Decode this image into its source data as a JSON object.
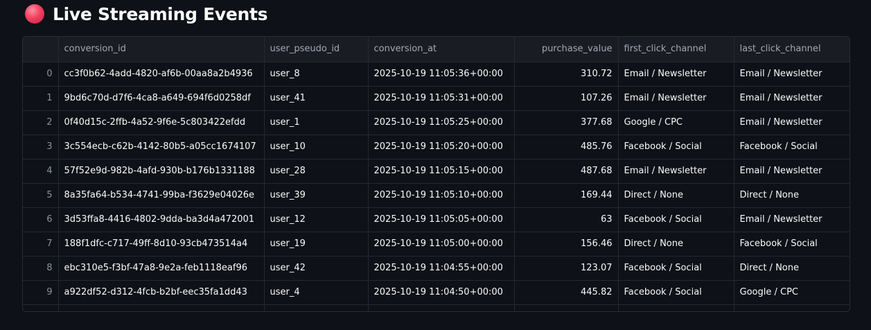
{
  "header": {
    "title": "Live Streaming Events",
    "icon": "red-circle-icon",
    "icon_color": "#f0415f"
  },
  "table": {
    "columns": [
      "",
      "conversion_id",
      "user_pseudo_id",
      "conversion_at",
      "purchase_value",
      "first_click_channel",
      "last_click_channel"
    ],
    "rows": [
      {
        "idx": "0",
        "conversion_id": "cc3f0b62-4add-4820-af6b-00aa8a2b4936",
        "user_pseudo_id": "user_8",
        "conversion_at": "2025-10-19 11:05:36+00:00",
        "purchase_value": "310.72",
        "first_click_channel": "Email / Newsletter",
        "last_click_channel": "Email / Newsletter"
      },
      {
        "idx": "1",
        "conversion_id": "9bd6c70d-d7f6-4ca8-a649-694f6d0258df",
        "user_pseudo_id": "user_41",
        "conversion_at": "2025-10-19 11:05:31+00:00",
        "purchase_value": "107.26",
        "first_click_channel": "Email / Newsletter",
        "last_click_channel": "Email / Newsletter"
      },
      {
        "idx": "2",
        "conversion_id": "0f40d15c-2ffb-4a52-9f6e-5c803422efdd",
        "user_pseudo_id": "user_1",
        "conversion_at": "2025-10-19 11:05:25+00:00",
        "purchase_value": "377.68",
        "first_click_channel": "Google / CPC",
        "last_click_channel": "Email / Newsletter"
      },
      {
        "idx": "3",
        "conversion_id": "3c554ecb-c62b-4142-80b5-a05cc1674107",
        "user_pseudo_id": "user_10",
        "conversion_at": "2025-10-19 11:05:20+00:00",
        "purchase_value": "485.76",
        "first_click_channel": "Facebook / Social",
        "last_click_channel": "Facebook / Social"
      },
      {
        "idx": "4",
        "conversion_id": "57f52e9d-982b-4afd-930b-b176b1331188",
        "user_pseudo_id": "user_28",
        "conversion_at": "2025-10-19 11:05:15+00:00",
        "purchase_value": "487.68",
        "first_click_channel": "Email / Newsletter",
        "last_click_channel": "Email / Newsletter"
      },
      {
        "idx": "5",
        "conversion_id": "8a35fa64-b534-4741-99ba-f3629e04026e",
        "user_pseudo_id": "user_39",
        "conversion_at": "2025-10-19 11:05:10+00:00",
        "purchase_value": "169.44",
        "first_click_channel": "Direct / None",
        "last_click_channel": "Direct / None"
      },
      {
        "idx": "6",
        "conversion_id": "3d53ffa8-4416-4802-9dda-ba3d4a472001",
        "user_pseudo_id": "user_12",
        "conversion_at": "2025-10-19 11:05:05+00:00",
        "purchase_value": "63",
        "first_click_channel": "Facebook / Social",
        "last_click_channel": "Email / Newsletter"
      },
      {
        "idx": "7",
        "conversion_id": "188f1dfc-c717-49ff-8d10-93cb473514a4",
        "user_pseudo_id": "user_19",
        "conversion_at": "2025-10-19 11:05:00+00:00",
        "purchase_value": "156.46",
        "first_click_channel": "Direct / None",
        "last_click_channel": "Facebook / Social"
      },
      {
        "idx": "8",
        "conversion_id": "ebc310e5-f3bf-47a8-9e2a-feb1118eaf96",
        "user_pseudo_id": "user_42",
        "conversion_at": "2025-10-19 11:04:55+00:00",
        "purchase_value": "123.07",
        "first_click_channel": "Facebook / Social",
        "last_click_channel": "Direct / None"
      },
      {
        "idx": "9",
        "conversion_id": "a922df52-d312-4fcb-b2bf-eec35fa1dd43",
        "user_pseudo_id": "user_4",
        "conversion_at": "2025-10-19 11:04:50+00:00",
        "purchase_value": "445.82",
        "first_click_channel": "Facebook / Social",
        "last_click_channel": "Google / CPC"
      }
    ]
  }
}
